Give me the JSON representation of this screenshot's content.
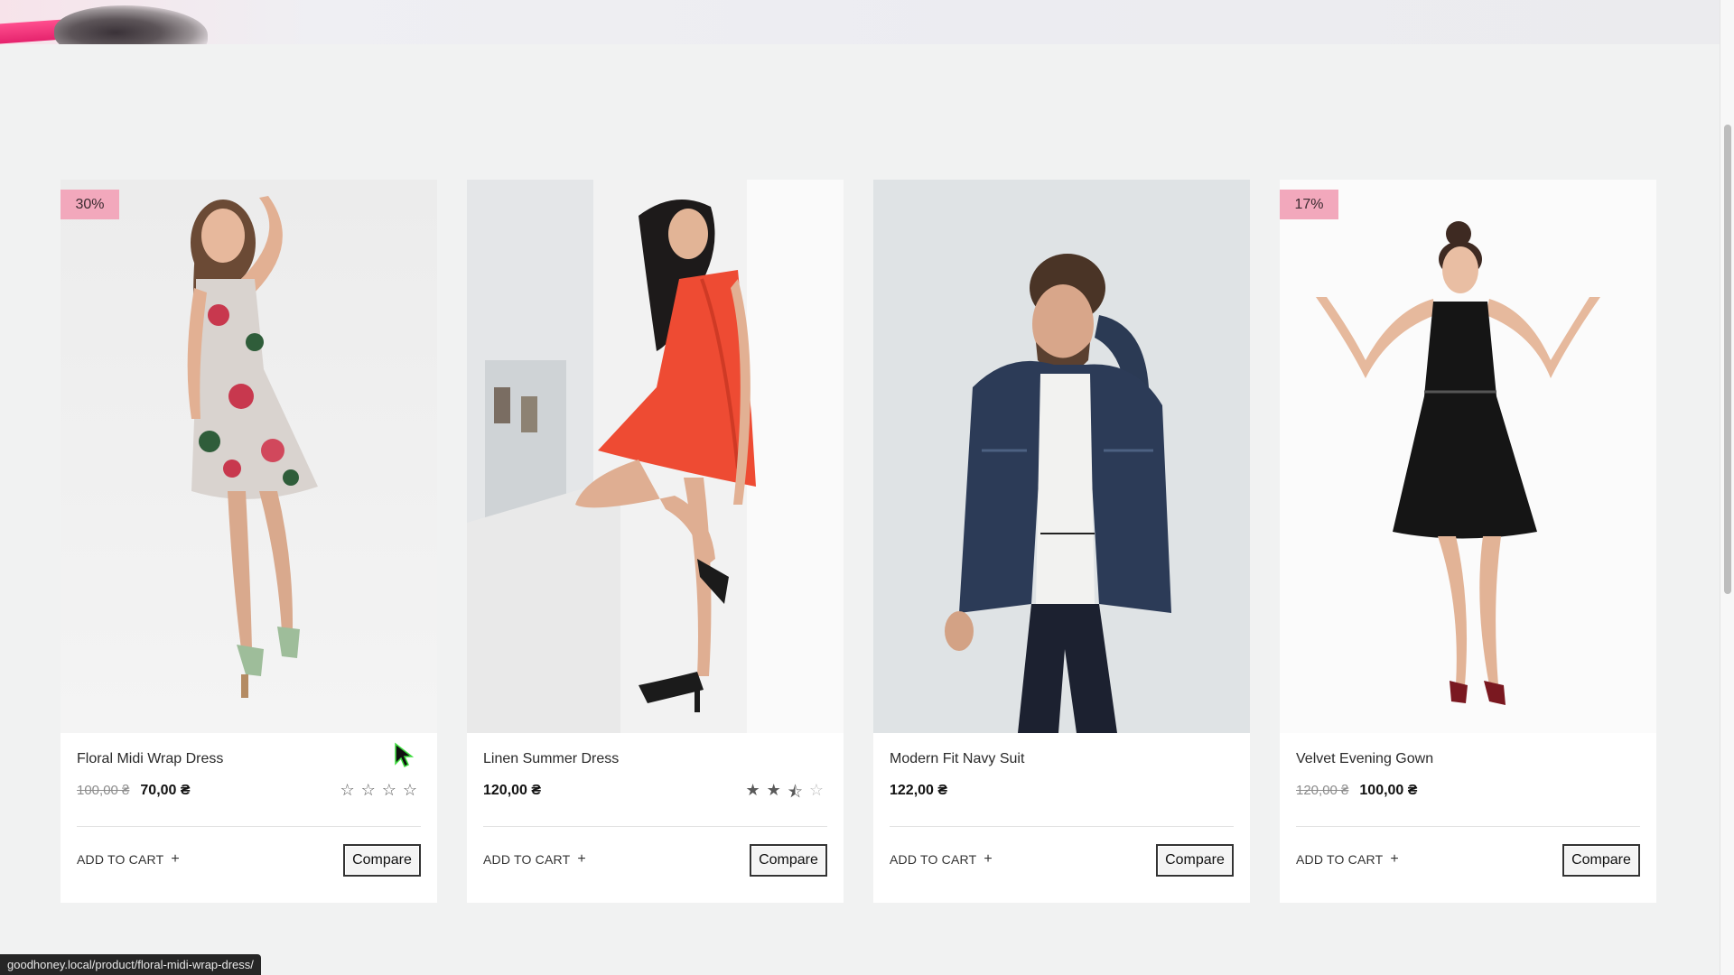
{
  "status_bar": {
    "url": "goodhoney.local/product/floral-midi-wrap-dress/"
  },
  "colors": {
    "badge": "#f2a8bc",
    "card": "#ffffff",
    "page": "#f1f2f2"
  },
  "products": [
    {
      "badge": "30%",
      "title": "Floral Midi Wrap Dress",
      "old_price": "100,00 ₴",
      "price": "70,00 ₴",
      "rating": 0,
      "show_rating": true,
      "add_to_cart": "ADD TO CART",
      "compare": "Compare"
    },
    {
      "badge": "",
      "title": "Linen Summer Dress",
      "old_price": "",
      "price": "120,00 ₴",
      "rating": 2.5,
      "show_rating": true,
      "add_to_cart": "ADD TO CART",
      "compare": "Compare"
    },
    {
      "badge": "",
      "title": "Modern Fit Navy Suit",
      "old_price": "",
      "price": "122,00 ₴",
      "rating": 0,
      "show_rating": false,
      "add_to_cart": "ADD TO CART",
      "compare": "Compare"
    },
    {
      "badge": "17%",
      "title": "Velvet Evening Gown",
      "old_price": "120,00 ₴",
      "price": "100,00 ₴",
      "rating": 0,
      "show_rating": false,
      "add_to_cart": "ADD TO CART",
      "compare": "Compare"
    }
  ]
}
